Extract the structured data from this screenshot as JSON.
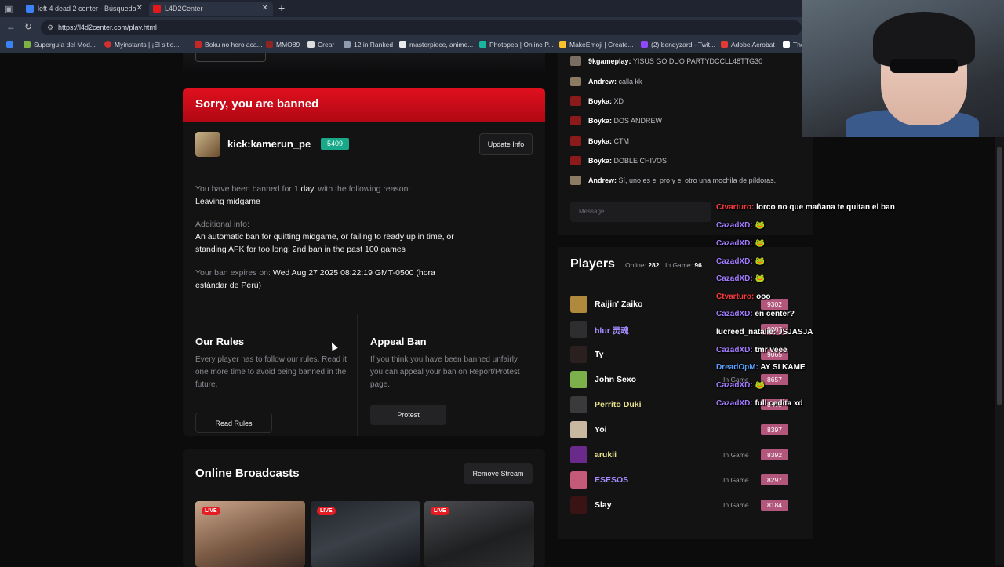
{
  "browser": {
    "tabs": [
      {
        "title": "left 4 dead 2 center - Búsqueda"
      },
      {
        "title": "L4D2Center"
      }
    ],
    "url": "https://l4d2center.com/play.html",
    "bookmarks": [
      "Superguía del Mod...",
      "Myinstants | ¡El sitio...",
      "Boku no hero aca...",
      "MMO89",
      "Crear",
      "12 in Ranked",
      "masterpiece, anime...",
      "Photopea | Online P...",
      "MakeEmoji | Create...",
      "(2) bendyzard - Twit...",
      "Adobe Acrobat",
      "The"
    ]
  },
  "ban": {
    "title": "Sorry, you are banned",
    "username": "kick:kamerun_pe",
    "rating": "5409",
    "update_label": "Update Info",
    "banned_for_prefix": "You have been banned for",
    "banned_for_duration": "1 day",
    "banned_for_suffix": ", with the following reason:",
    "reason": "Leaving midgame",
    "additional_label": "Additional info:",
    "additional_text": "An automatic ban for quitting midgame, or failing to ready up in time, or standing AFK for too long; 2nd ban in the past 100 games",
    "expires_label": "Your ban expires on:",
    "expires_value": "Wed Aug 27 2025 08:22:19 GMT-0500 (hora estándar de Perú)",
    "rules_title": "Our Rules",
    "rules_text": "Every player has to follow our rules. Read it one more time to avoid being banned in the future.",
    "rules_button": "Read Rules",
    "appeal_title": "Appeal Ban",
    "appeal_text": "If you think you have been banned unfairly, you can appeal your ban on Report/Protest page.",
    "appeal_button": "Protest"
  },
  "broadcasts": {
    "title": "Online Broadcasts",
    "remove_label": "Remove Stream",
    "live_badge": "LIVE"
  },
  "chat": {
    "messages": [
      {
        "user": "9kgameplay:",
        "text": "YISUS GO DUO PARTYDCCLL48TTG30"
      },
      {
        "user": "Andrew:",
        "text": "calla kk"
      },
      {
        "user": "Boyka:",
        "text": "XD"
      },
      {
        "user": "Boyka:",
        "text": "DOS ANDREW"
      },
      {
        "user": "Boyka:",
        "text": "CTM"
      },
      {
        "user": "Boyka:",
        "text": "DOBLE CHIVOS"
      },
      {
        "user": "Andrew:",
        "text": "Sí, uno es el pro y el otro una mochila de píldoras."
      }
    ],
    "placeholder": "Message..."
  },
  "players": {
    "title": "Players",
    "online_label": "Online:",
    "online_count": "282",
    "ingame_label": "In Game:",
    "ingame_count": "96",
    "list": [
      {
        "name": "Raijin' Zaiko",
        "status": "",
        "score": "9302",
        "color": "#ffffff"
      },
      {
        "name": "blur 灵魂",
        "status": "",
        "score": "9287",
        "color": "#a58cff"
      },
      {
        "name": "Ty",
        "status": "",
        "score": "9065",
        "color": "#ffffff"
      },
      {
        "name": "John Sexo",
        "status": "In Game",
        "score": "8657",
        "color": "#ffffff"
      },
      {
        "name": "Perrito Duki",
        "status": "",
        "score": "8478",
        "color": "#e6e08a"
      },
      {
        "name": "Yoi",
        "status": "",
        "score": "8397",
        "color": "#ffffff"
      },
      {
        "name": "arukii",
        "status": "In Game",
        "score": "8392",
        "color": "#e6e08a"
      },
      {
        "name": "ESESOS",
        "status": "In Game",
        "score": "8297",
        "color": "#a58cff"
      },
      {
        "name": "Slay",
        "status": "In Game",
        "score": "8184",
        "color": "#ffffff"
      }
    ]
  },
  "stream_overlay": [
    {
      "user": "Ctvarturo:",
      "text": "lorco no que mañana te quitan el ban",
      "color": "#ff3b3b"
    },
    {
      "user": "CazadXD:",
      "text": "🐸",
      "color": "#a27cff"
    },
    {
      "user": "CazadXD:",
      "text": "🐸",
      "color": "#a27cff"
    },
    {
      "user": "CazadXD:",
      "text": "🐸",
      "color": "#a27cff"
    },
    {
      "user": "CazadXD:",
      "text": "🐸",
      "color": "#a27cff"
    },
    {
      "user": "Ctvarturo:",
      "text": "ooo",
      "color": "#ff3b3b"
    },
    {
      "user": "CazadXD:",
      "text": "en center?",
      "color": "#a27cff"
    },
    {
      "user": "lucreed_natalie:",
      "text": "JSJASJA",
      "color": "#ffffff"
    },
    {
      "user": "CazadXD:",
      "text": "tmr veee",
      "color": "#a27cff"
    },
    {
      "user": "DreadOpM:",
      "text": "AY SI KAME",
      "color": "#5aa3ff"
    },
    {
      "user": "CazadXD:",
      "text": "🐸",
      "color": "#a27cff"
    },
    {
      "user": "CazadXD:",
      "text": "full cedita xd",
      "color": "#a27cff"
    }
  ]
}
